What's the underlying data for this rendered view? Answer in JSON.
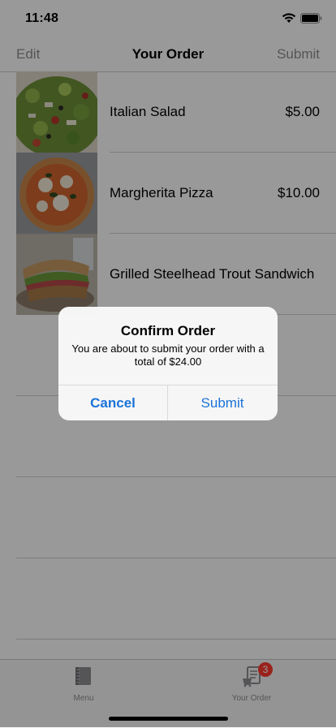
{
  "status": {
    "time": "11:48",
    "icons": [
      "wifi-icon",
      "battery-icon"
    ]
  },
  "nav": {
    "left": "Edit",
    "title": "Your Order",
    "right": "Submit"
  },
  "order": {
    "items": [
      {
        "name": "Italian Salad",
        "price": "$5.00",
        "image": "italian-salad"
      },
      {
        "name": "Margherita Pizza",
        "price": "$10.00",
        "image": "margherita-pizza"
      },
      {
        "name": "Grilled Steelhead Trout Sandwich",
        "price": "",
        "image": "trout-sandwich"
      }
    ]
  },
  "tabs": [
    {
      "label": "Menu",
      "icon": "menu-book-icon"
    },
    {
      "label": "Your Order",
      "icon": "order-receipt-icon",
      "badge": "3"
    }
  ],
  "alert": {
    "title": "Confirm Order",
    "message": "You are about to submit your order with a total of $24.00",
    "cancel": "Cancel",
    "submit": "Submit"
  },
  "colors": {
    "accent": "#1a73d9",
    "badge": "#ff3b30",
    "muted": "#8e8e93"
  }
}
